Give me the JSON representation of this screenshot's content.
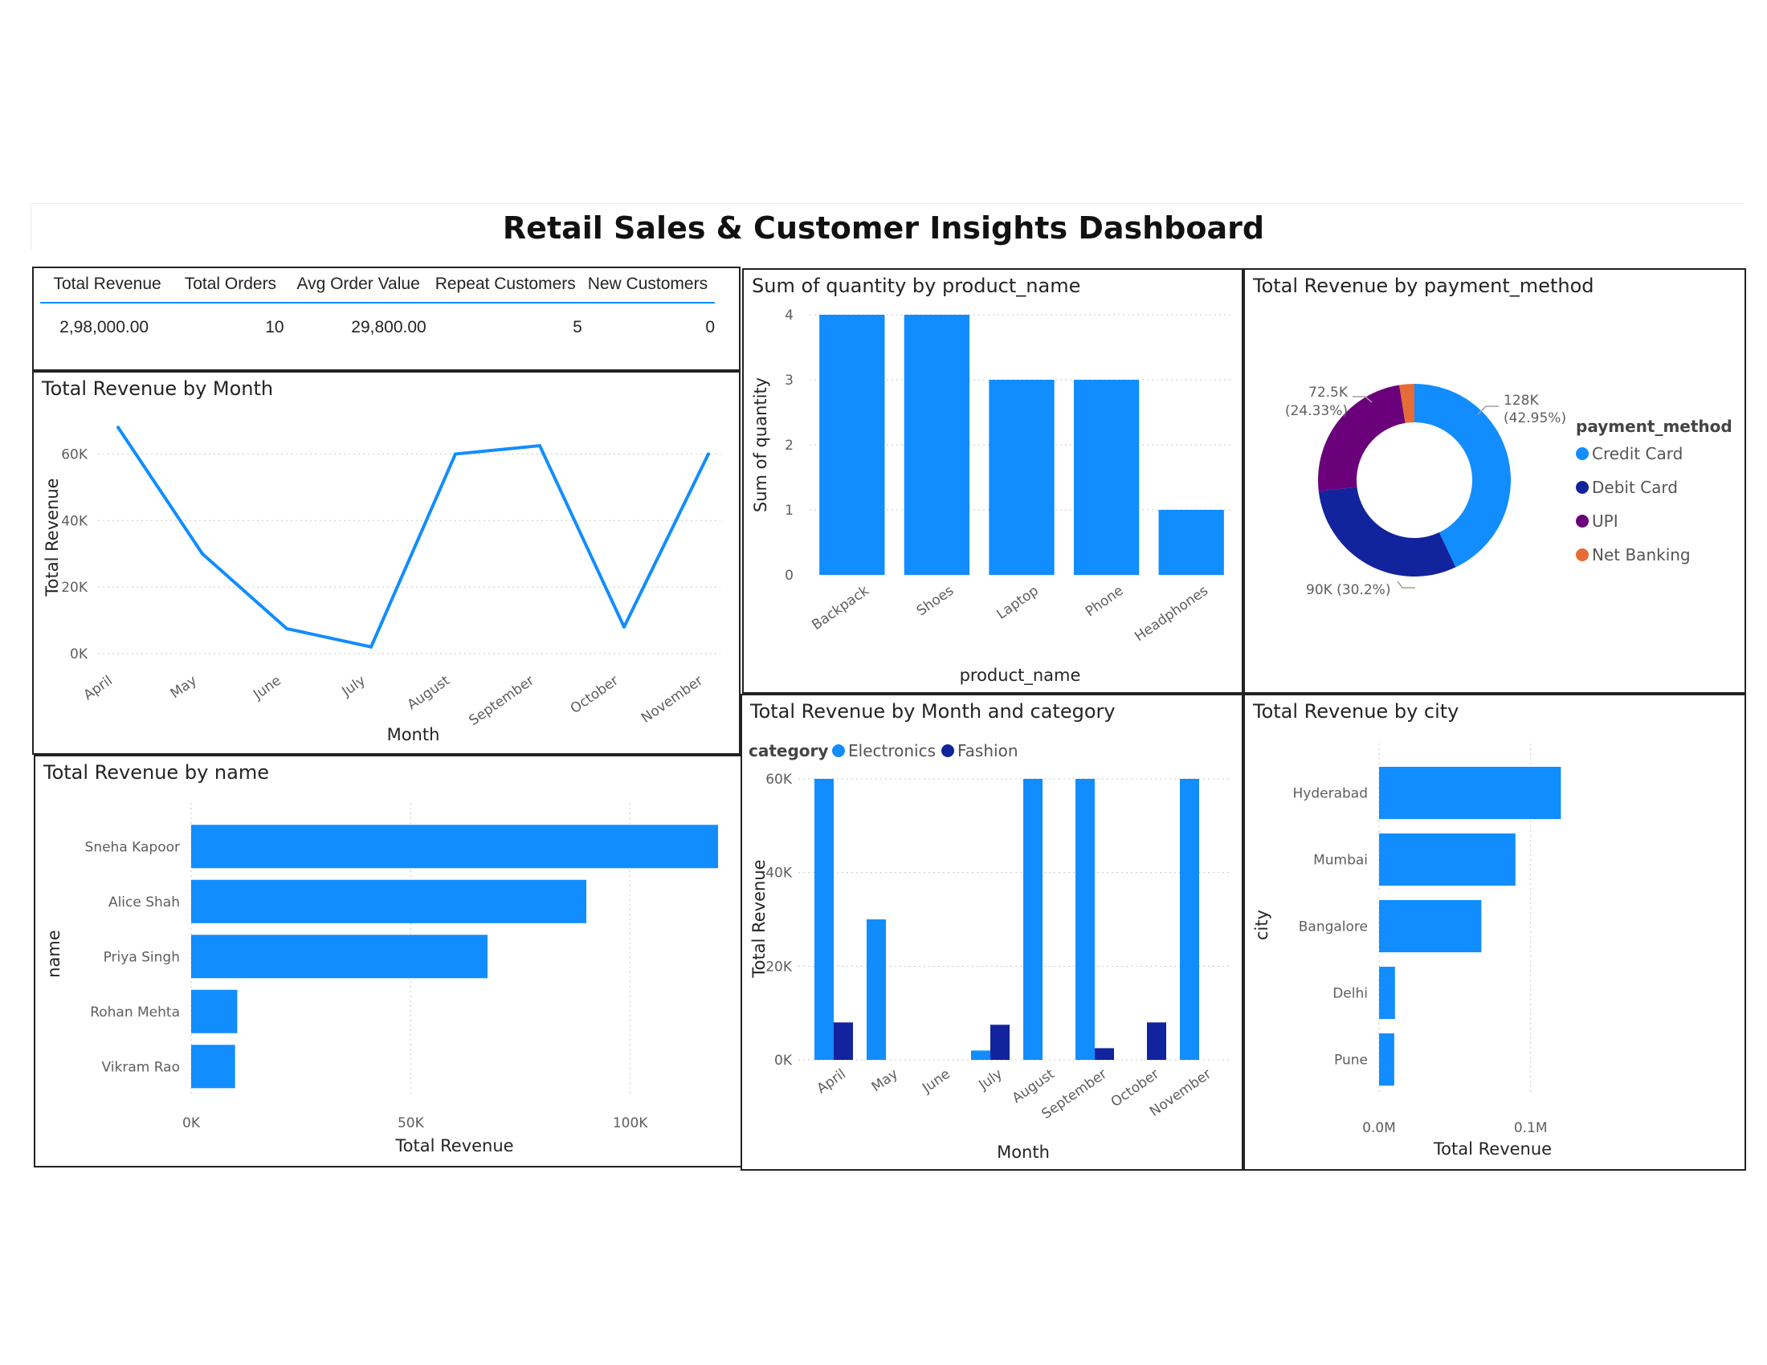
{
  "dashboard": {
    "title": "Retail Sales & Customer Insights Dashboard"
  },
  "kpi": {
    "headers": [
      "Total Revenue",
      "Total Orders",
      "Avg Order Value",
      "Repeat Customers",
      "New Customers"
    ],
    "values": [
      "2,98,000.00",
      "10",
      "29,800.00",
      "5",
      "0"
    ]
  },
  "colors": {
    "accent": "#118dff",
    "dark_blue": "#12239e",
    "purple": "#6b007b",
    "orange": "#e66c37"
  },
  "chart_data": [
    {
      "id": "revenue_by_month",
      "type": "line",
      "title": "Total Revenue by Month",
      "xlabel": "Month",
      "ylabel": "Total Revenue",
      "categories": [
        "April",
        "May",
        "June",
        "July",
        "August",
        "September",
        "October",
        "November"
      ],
      "values": [
        68000,
        30000,
        7500,
        2000,
        60000,
        62500,
        8000,
        60000
      ],
      "ylim": [
        0,
        70000
      ],
      "yticks": [
        0,
        20000,
        40000,
        60000
      ],
      "ytick_labels": [
        "0K",
        "20K",
        "40K",
        "60K"
      ],
      "grid": true
    },
    {
      "id": "quantity_by_product",
      "type": "bar",
      "title": "Sum of quantity by product_name",
      "xlabel": "product_name",
      "ylabel": "Sum of quantity",
      "categories": [
        "Backpack",
        "Shoes",
        "Laptop",
        "Phone",
        "Headphones"
      ],
      "values": [
        4,
        4,
        3,
        3,
        1
      ],
      "ylim": [
        0,
        4
      ],
      "yticks": [
        0,
        1,
        2,
        3,
        4
      ],
      "ytick_labels": [
        "0",
        "1",
        "2",
        "3",
        "4"
      ],
      "grid": true
    },
    {
      "id": "revenue_by_payment",
      "type": "pie",
      "title": "Total Revenue by payment_method",
      "legend_title": "payment_method",
      "legend_position": "right",
      "labels": [
        "Credit Card",
        "Debit Card",
        "UPI",
        "Net Banking"
      ],
      "values": [
        128000,
        90000,
        72500,
        7500
      ],
      "colors": [
        "#118dff",
        "#12239e",
        "#6b007b",
        "#e66c37"
      ],
      "data_labels": [
        {
          "value": "128K",
          "pct": "(42.95%)"
        },
        {
          "value": "90K (30.2%)",
          "pct": ""
        },
        {
          "value": "72.5K",
          "pct": "(24.33%)"
        }
      ]
    },
    {
      "id": "revenue_by_name",
      "type": "bar",
      "orientation": "horizontal",
      "title": "Total Revenue by name",
      "xlabel": "Total Revenue",
      "ylabel": "name",
      "categories": [
        "Sneha Kapoor",
        "Alice Shah",
        "Priya Singh",
        "Rohan Mehta",
        "Vikram Rao"
      ],
      "values": [
        120000,
        90000,
        67500,
        10500,
        10000
      ],
      "xlim": [
        0,
        120000
      ],
      "xticks": [
        0,
        50000,
        100000
      ],
      "xtick_labels": [
        "0K",
        "50K",
        "100K"
      ],
      "grid": true
    },
    {
      "id": "revenue_by_month_category",
      "type": "bar",
      "title": "Total Revenue by Month and category",
      "xlabel": "Month",
      "ylabel": "Total Revenue",
      "legend_title": "category",
      "legend_position": "top-left",
      "categories": [
        "April",
        "May",
        "June",
        "July",
        "August",
        "September",
        "October",
        "November"
      ],
      "series": [
        {
          "name": "Electronics",
          "values": [
            60000,
            30000,
            0,
            2000,
            60000,
            60000,
            0,
            60000
          ]
        },
        {
          "name": "Fashion",
          "values": [
            8000,
            0,
            0,
            7500,
            0,
            2500,
            8000,
            0
          ]
        }
      ],
      "ylim": [
        0,
        60000
      ],
      "yticks": [
        0,
        20000,
        40000,
        60000
      ],
      "ytick_labels": [
        "0K",
        "20K",
        "40K",
        "60K"
      ],
      "grid": true
    },
    {
      "id": "revenue_by_city",
      "type": "bar",
      "orientation": "horizontal",
      "title": "Total Revenue by city",
      "xlabel": "Total Revenue",
      "ylabel": "city",
      "categories": [
        "Hyderabad",
        "Mumbai",
        "Bangalore",
        "Delhi",
        "Pune"
      ],
      "values": [
        120000,
        90000,
        67500,
        10500,
        10000
      ],
      "xlim": [
        0,
        150000
      ],
      "xticks": [
        0,
        100000
      ],
      "xtick_labels": [
        "0.0M",
        "0.1M"
      ],
      "grid": true
    }
  ]
}
